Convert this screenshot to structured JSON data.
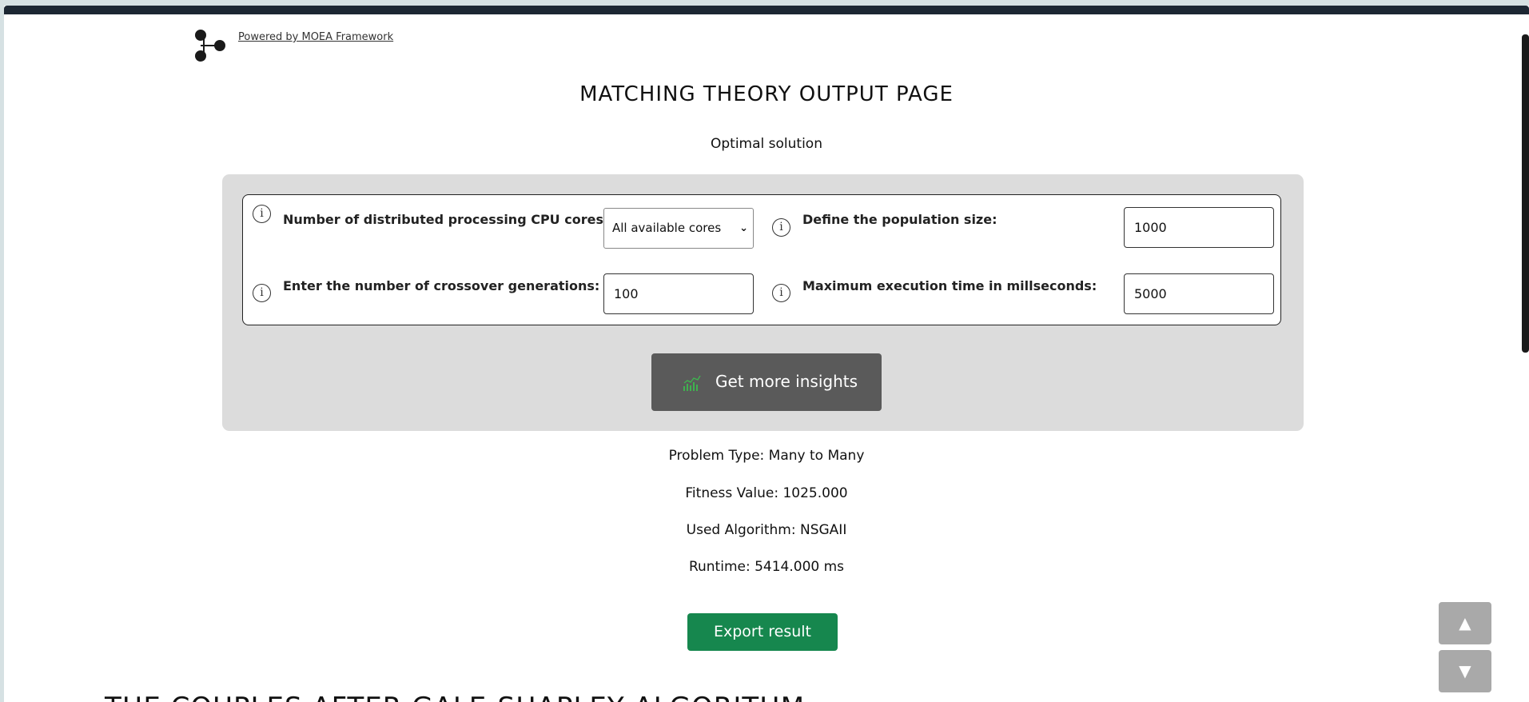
{
  "header": {
    "powered_by": "Powered by MOEA Framework",
    "page_title": "MATCHING THEORY OUTPUT PAGE",
    "subtitle": "Optimal solution"
  },
  "form": {
    "cores_label": "Number of distributed processing CPU cores:",
    "cores_value": "All available cores",
    "population_label": "Define the population size:",
    "population_value": "1000",
    "generations_label": "Enter the number of crossover generations:",
    "generations_value": "100",
    "exectime_label": "Maximum execution time in millseconds:",
    "exectime_value": "5000",
    "insights_button": "Get more insights"
  },
  "results": {
    "problem_type": "Problem Type: Many to Many",
    "fitness_value": "Fitness Value: 1025.000",
    "algorithm": "Used Algorithm: NSGAII",
    "runtime": "Runtime: 5414.000 ms",
    "export_button": "Export result"
  },
  "section": {
    "heading": "THE COUPLES AFTER GALE-SHAPLEY ALGORITHM"
  },
  "colors": {
    "export_green": "#16874e",
    "insights_gray": "#5a5a5a",
    "panel_gray": "#dcdcdc"
  },
  "icons": {
    "info": "info-icon",
    "chart": "bar-chart-icon",
    "up": "chevron-up-icon",
    "down": "chevron-down-icon"
  }
}
